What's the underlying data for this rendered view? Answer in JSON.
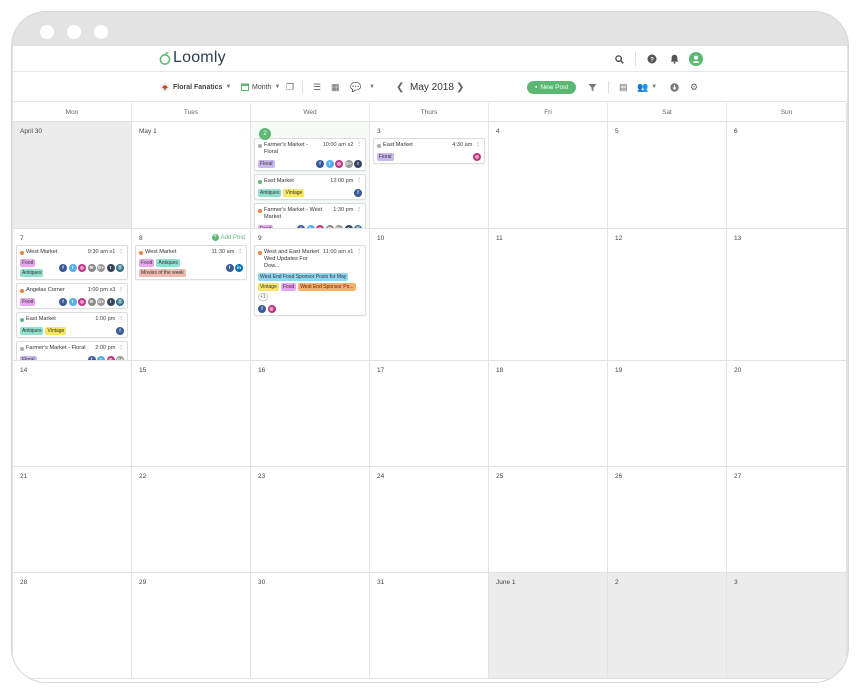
{
  "app": {
    "logo": "Loomly"
  },
  "toolbar": {
    "calendar_name": "Floral Fanatics",
    "view": "Month",
    "month_title": "May 2018",
    "new_post": "New Post",
    "icons": [
      "copy-icon",
      "list-view-icon",
      "grid-view-icon",
      "comments-icon",
      "filter-icon",
      "library-icon",
      "users-icon",
      "download-icon",
      "settings-icon"
    ]
  },
  "top_icons": [
    "search-icon",
    "help-icon",
    "bell-icon",
    "user-avatar-icon"
  ],
  "colors": {
    "accent": "#5cb874",
    "tag_food": "#e7a7ee",
    "tag_antiques": "#8fe0cf",
    "tag_vintage": "#f6e46b",
    "tag_floral": "#c9b7ef",
    "tag_movies": "#f2b9b0",
    "tag_sponsor": "#8fd6f2",
    "tag_sponsor2": "#f5b06b",
    "status_green": "#5cb874",
    "status_orange": "#e8833a",
    "status_gray": "#aaaaaa"
  },
  "day_names": [
    "Mon",
    "Tues",
    "Wed",
    "Thurs",
    "Fri",
    "Sat",
    "Sun"
  ],
  "add_post_label": "Add Post",
  "weeks": [
    {
      "days": [
        {
          "label": "April 30",
          "gray": true,
          "posts": []
        },
        {
          "label": "May 1",
          "posts": []
        },
        {
          "label": "2",
          "today": true,
          "posts": [
            {
              "status": "gray",
              "title": "Farmer's Market - Floral",
              "time": "10:00 am x2",
              "tags": [
                [
                  "Floral",
                  "floral"
                ]
              ],
              "socials": [
                "facebook",
                "twitter",
                "instagram",
                "googleplus",
                "tumblr"
              ]
            },
            {
              "status": "green",
              "title": "East Market",
              "time": "12:00 pm",
              "tags": [
                [
                  "Antiques",
                  "antiques"
                ],
                [
                  "Vintage",
                  "vintage"
                ]
              ],
              "socials": [
                "facebook"
              ]
            },
            {
              "status": "orange",
              "title": "Farmer's Market - West Market",
              "time": "1:30 pm",
              "tags": [
                [
                  "Food",
                  "food"
                ]
              ],
              "socials": [
                "facebook",
                "twitter",
                "instagram",
                "email",
                "googleplus",
                "tumblr",
                "pinterest"
              ]
            }
          ]
        },
        {
          "label": "3",
          "posts": [
            {
              "status": "gray",
              "title": "East Market",
              "time": "4:30 am",
              "tags": [
                [
                  "Floral",
                  "floral"
                ]
              ],
              "socials": [
                "instagram"
              ]
            }
          ]
        },
        {
          "label": "4",
          "posts": []
        },
        {
          "label": "5",
          "posts": []
        },
        {
          "label": "6",
          "posts": []
        }
      ]
    },
    {
      "days": [
        {
          "label": "7",
          "posts": [
            {
              "status": "orange",
              "title": "West Market",
              "time": "9:30 am x1",
              "tags": [
                [
                  "Food",
                  "food"
                ],
                [
                  "Antiques",
                  "antiques"
                ]
              ],
              "socials": [
                "facebook",
                "twitter",
                "instagram",
                "email",
                "googleplus",
                "tumblr",
                "pinterest"
              ]
            },
            {
              "status": "orange",
              "title": "Angelas Corner",
              "time": "1:00 pm x3",
              "tags": [
                [
                  "Food",
                  "food"
                ]
              ],
              "socials": [
                "facebook",
                "twitter",
                "instagram",
                "email",
                "googleplus",
                "tumblr",
                "pinterest"
              ]
            },
            {
              "status": "green",
              "title": "East Market",
              "time": "1:00 pm",
              "tags": [
                [
                  "Antiques",
                  "antiques"
                ],
                [
                  "Vintage",
                  "vintage"
                ]
              ],
              "socials": [
                "facebook"
              ]
            },
            {
              "status": "gray",
              "title": "Farmer's Market - Floral",
              "time": "2:00 pm",
              "tags": [
                [
                  "Floral",
                  "floral"
                ]
              ],
              "socials": [
                "facebook",
                "twitter",
                "instagram",
                "googleplus"
              ]
            }
          ]
        },
        {
          "label": "8",
          "add_post": true,
          "posts": [
            {
              "status": "orange",
              "title": "West Market",
              "time": "11:30 am",
              "tags": [
                [
                  "Food",
                  "food"
                ],
                [
                  "Antiques",
                  "antiques"
                ],
                [
                  "Movies of the week",
                  "movies"
                ]
              ],
              "socials": [
                "facebook",
                "linkedin"
              ]
            }
          ]
        },
        {
          "label": "9",
          "posts": [
            {
              "status": "orange",
              "title": "West and East Market Wed Updates For Dow...",
              "time": "11:00 am x1",
              "tags": [
                [
                  "West End Food Sponsor Posts for May",
                  "sponsor"
                ],
                [
                  "Vintage",
                  "vintage"
                ],
                [
                  "Food",
                  "food"
                ],
                [
                  "West End Sponsor Po...",
                  "sponsor2"
                ]
              ],
              "extra": "+1",
              "socials": [
                "facebook",
                "instagram"
              ]
            }
          ]
        },
        {
          "label": "10",
          "posts": []
        },
        {
          "label": "11",
          "posts": []
        },
        {
          "label": "12",
          "posts": []
        },
        {
          "label": "13",
          "posts": []
        }
      ]
    },
    {
      "days": [
        {
          "label": "14",
          "posts": []
        },
        {
          "label": "15",
          "posts": []
        },
        {
          "label": "16",
          "posts": []
        },
        {
          "label": "17",
          "posts": []
        },
        {
          "label": "18",
          "posts": []
        },
        {
          "label": "19",
          "posts": []
        },
        {
          "label": "20",
          "posts": []
        }
      ]
    },
    {
      "days": [
        {
          "label": "21",
          "posts": []
        },
        {
          "label": "22",
          "posts": []
        },
        {
          "label": "23",
          "posts": []
        },
        {
          "label": "24",
          "posts": []
        },
        {
          "label": "25",
          "posts": []
        },
        {
          "label": "26",
          "posts": []
        },
        {
          "label": "27",
          "posts": []
        }
      ]
    },
    {
      "days": [
        {
          "label": "28",
          "posts": []
        },
        {
          "label": "29",
          "posts": []
        },
        {
          "label": "30",
          "posts": []
        },
        {
          "label": "31",
          "posts": []
        },
        {
          "label": "June 1",
          "gray": true,
          "posts": []
        },
        {
          "label": "2",
          "gray": true,
          "posts": []
        },
        {
          "label": "3",
          "gray": true,
          "posts": []
        }
      ]
    }
  ]
}
